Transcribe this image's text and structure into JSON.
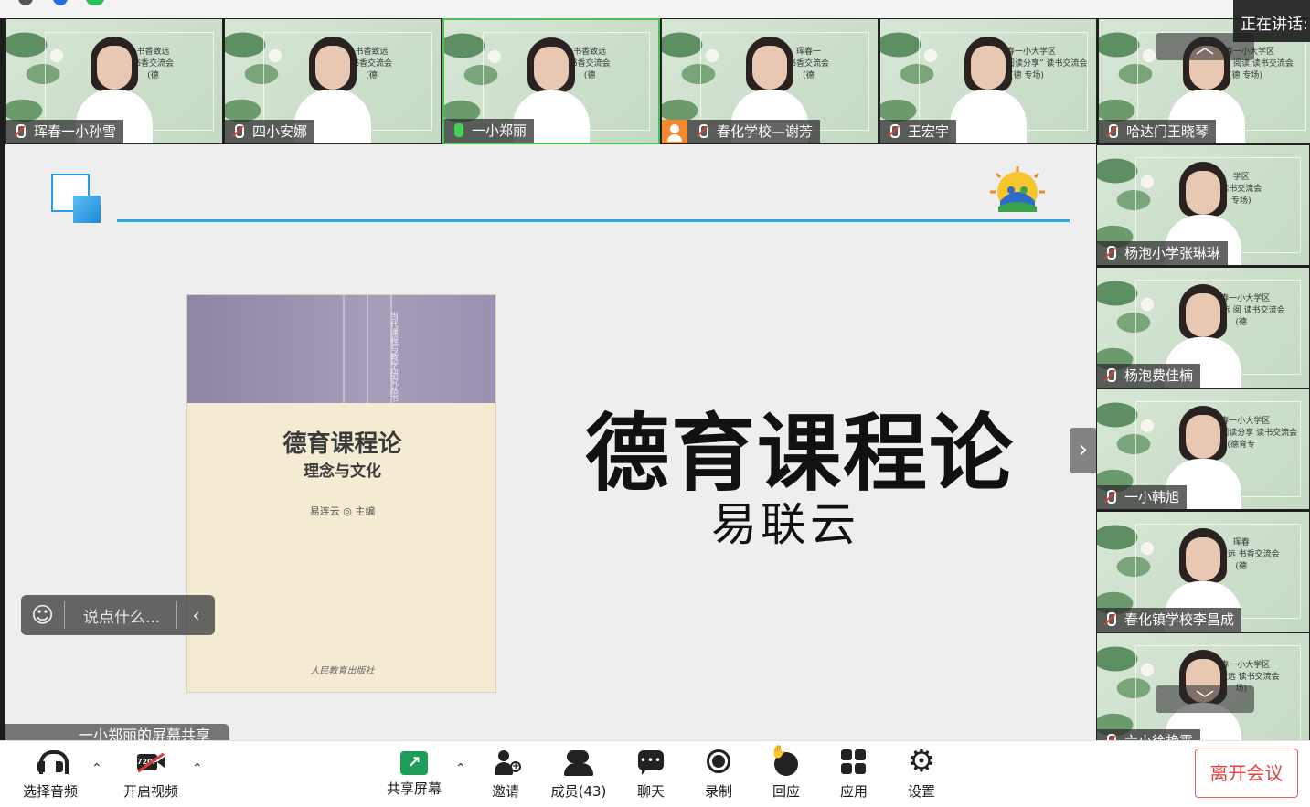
{
  "speaking": {
    "label": "正在讲话:"
  },
  "participants_top": [
    {
      "name": "珲春一小孙雪",
      "mic": "muted",
      "caption_line1": "书香致远",
      "caption_line2": "书香交流会",
      "caption_line3": "(德"
    },
    {
      "name": "四小安娜",
      "mic": "muted",
      "caption_line1": "书香致远",
      "caption_line2": "书香交流会",
      "caption_line3": "(德"
    },
    {
      "name": "一小郑丽",
      "mic": "on",
      "caption_line1": "书香致远",
      "caption_line2": "书香交流会",
      "caption_line3": "(德"
    },
    {
      "name": "春化学校—谢芳",
      "mic": "muted",
      "caption_line1": "珲春一",
      "caption_line2": "书香交流会",
      "caption_line3": "(德"
    },
    {
      "name": "王宏宇",
      "mic": "muted",
      "caption_line1": "珲春一小大学区",
      "caption_line2": "“书香致远 阅读分享” 读书交流会",
      "caption_line3": "(德 专场)"
    },
    {
      "name": "哈达门王晓琴",
      "mic": "muted",
      "caption_line1": "珲春一小大学区",
      "caption_line2": "书香致远 阅读 读书交流会",
      "caption_line3": "(德 专场)"
    }
  ],
  "participants_side": [
    {
      "name": "杨泡小学张琳琳",
      "mic": "muted",
      "caption_line1": "学区",
      "caption_line2": "读书交流会",
      "caption_line3": "专场)"
    },
    {
      "name": "杨泡费佳楠",
      "mic": "muted",
      "caption_line1": "珲春一小大学区",
      "caption_line2": "书香致远 阅 读书交流会",
      "caption_line3": "(德"
    },
    {
      "name": "一小韩旭",
      "mic": "muted",
      "caption_line1": "珲春一小大学区",
      "caption_line2": "书香致远 阅读分享 读书交流会",
      "caption_line3": "(德育专"
    },
    {
      "name": "春化镇学校李昌成",
      "mic": "muted",
      "caption_line1": "珲春",
      "caption_line2": "书香致远 书香交流会",
      "caption_line3": "(德"
    },
    {
      "name": "六小徐艳霞",
      "mic": "muted",
      "caption_line1": "珲春一小大学区",
      "caption_line2": "书香致远 读书交流会",
      "caption_line3": "场)"
    }
  ],
  "scroll": {
    "up": "︿",
    "down": "﹀"
  },
  "share": {
    "presenter_label": "一小郑丽的屏幕共享",
    "slide_title": "德育课程论",
    "slide_author": "易联云",
    "book": {
      "title": "德育课程论",
      "subtitle": "理念与文化",
      "author": "易连云 ◎ 主编",
      "series": "当代课程与教学研究丛书",
      "publisher": "人民教育出版社"
    },
    "next_arrow": "›",
    "chat_placeholder": "说点什么...",
    "chat_emoji": "☺",
    "chat_collapse": "‹"
  },
  "toolbar": {
    "audio": "选择音频",
    "video": "开启视频",
    "video_badge": "720P",
    "share": "共享屏幕",
    "invite": "邀请",
    "members": "成员(43)",
    "chat": "聊天",
    "record": "录制",
    "react": "回应",
    "apps": "应用",
    "settings": "设置",
    "leave": "离开会议",
    "caret": "⌃"
  },
  "colors": {
    "accent": "#2aa6e0",
    "share_green": "#1f9c58",
    "leave_red": "#e04040",
    "mic_muted": "#e23b3b",
    "mic_on": "#44d15a"
  }
}
